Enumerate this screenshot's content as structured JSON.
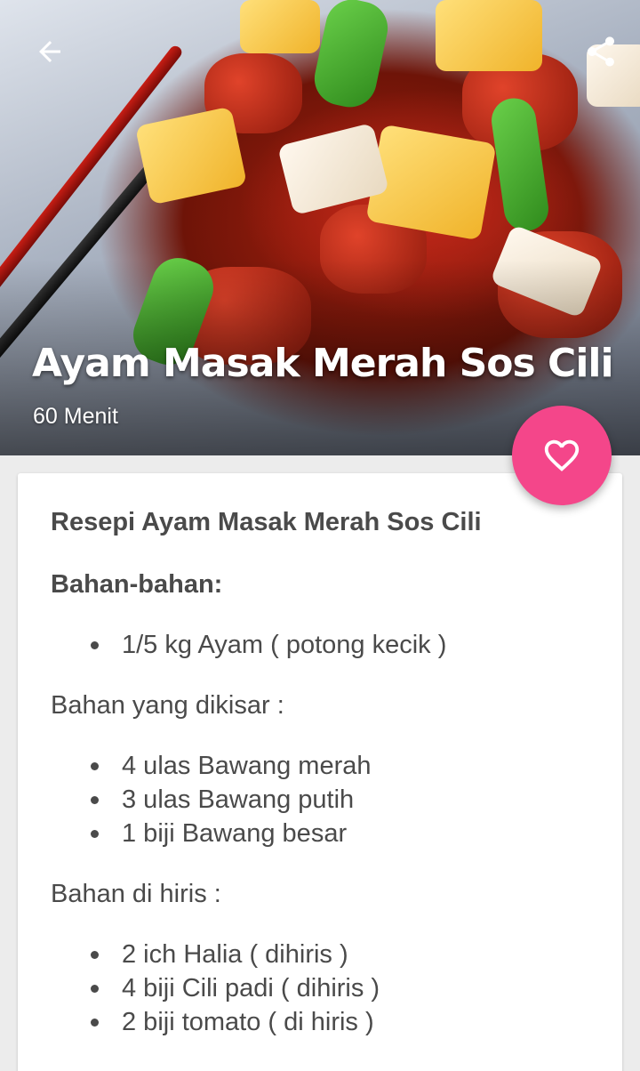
{
  "recipe": {
    "title": "Ayam Masak Merah Sos Cili",
    "duration": "60 Menit"
  },
  "content": {
    "recipe_heading": "Resepi Ayam Masak Merah Sos Cili",
    "ingredients_heading": "Bahan-bahan:",
    "main_items": [
      "1/5 kg  Ayam ( potong kecik )"
    ],
    "blended_heading": "Bahan yang dikisar :",
    "blended_items": [
      "4 ulas Bawang merah",
      "3 ulas Bawang putih",
      "1 biji Bawang besar"
    ],
    "sliced_heading": "Bahan di hiris :",
    "sliced_items": [
      "2 ich Halia ( dihiris )",
      "4 biji Cili padi ( dihiris )",
      "2 biji tomato ( di hiris )"
    ]
  },
  "icons": {
    "back": "arrow-left-icon",
    "share": "share-icon",
    "favorite": "heart-outline-icon"
  },
  "colors": {
    "accent": "#f4468a",
    "text": "#4a4a4a",
    "background": "#ececec"
  }
}
